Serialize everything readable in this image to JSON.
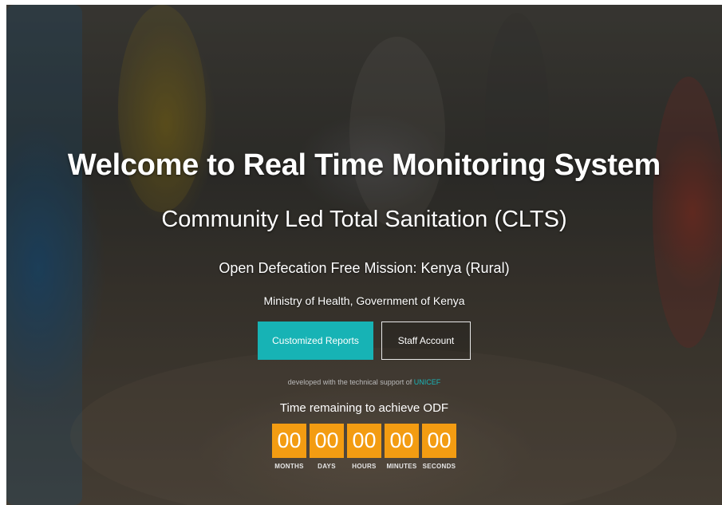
{
  "hero": {
    "title": "Welcome to Real Time Monitoring System",
    "subtitle": "Community Led Total Sanitation (CLTS)",
    "mission": "Open Defecation Free Mission: Kenya (Rural)",
    "ministry": "Ministry of Health, Government of Kenya"
  },
  "buttons": {
    "reports_label": "Customized Reports",
    "staff_label": "Staff Account"
  },
  "support": {
    "text": "developed with the technical support of ",
    "link": "UNICEF"
  },
  "countdown": {
    "title": "Time remaining to achieve ODF",
    "units": [
      {
        "value": "00",
        "label": "MONTHS"
      },
      {
        "value": "00",
        "label": "DAYS"
      },
      {
        "value": "00",
        "label": "HOURS"
      },
      {
        "value": "00",
        "label": "MINUTES"
      },
      {
        "value": "00",
        "label": "SECONDS"
      }
    ]
  },
  "colors": {
    "primary_button": "#17b3b5",
    "countdown_box": "#f39c12",
    "link": "#19b5b8"
  }
}
